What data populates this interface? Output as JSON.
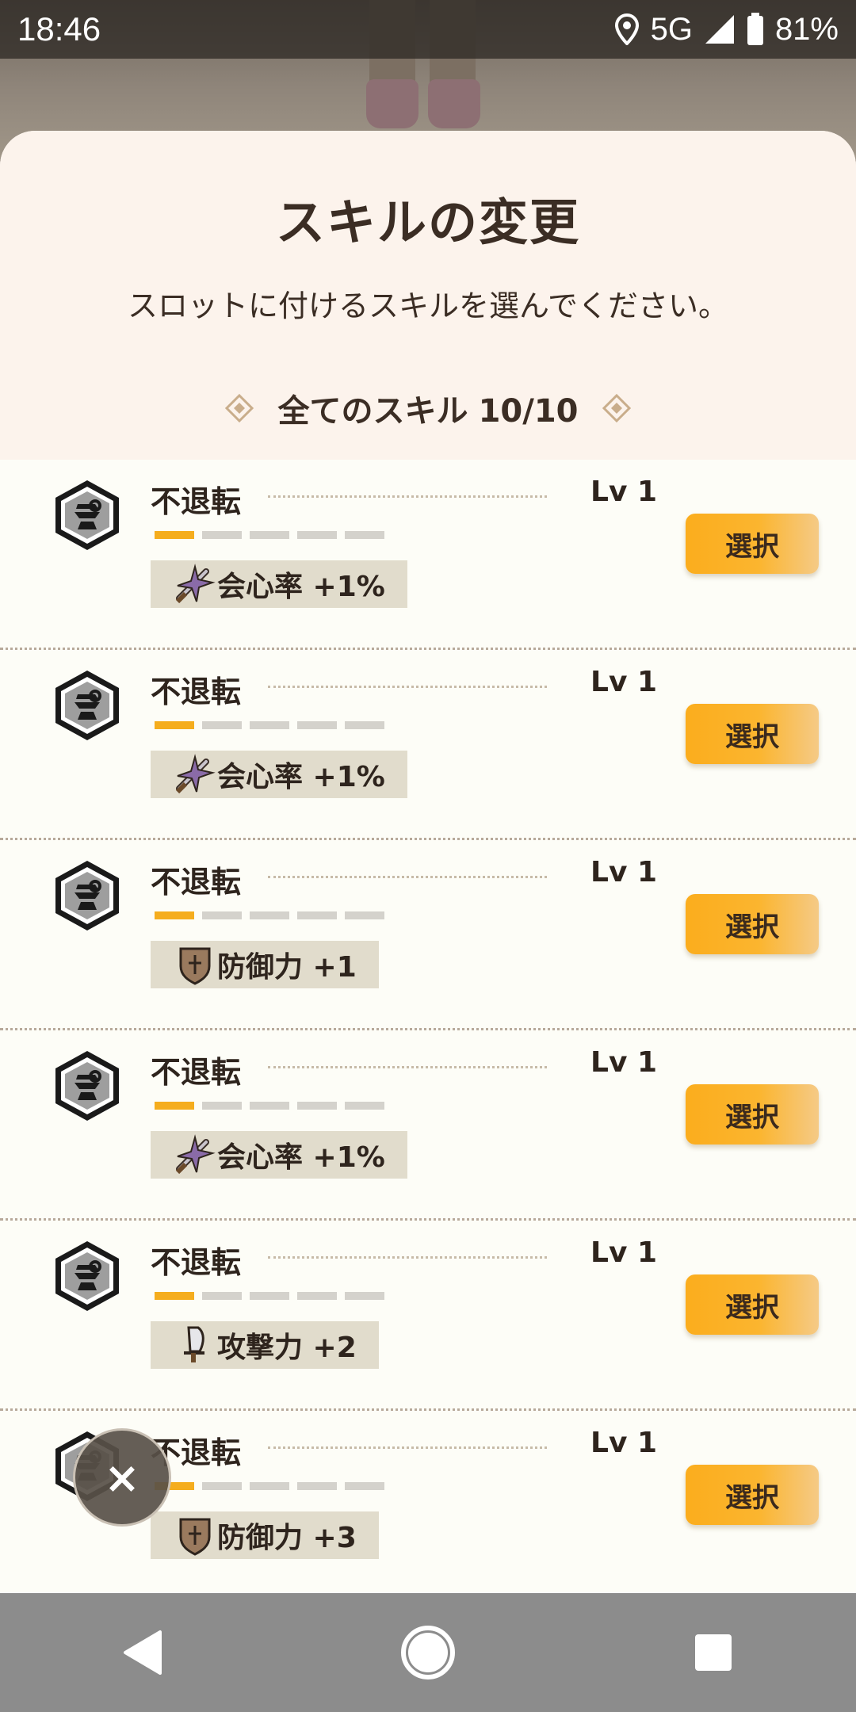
{
  "status_bar": {
    "time": "18:46",
    "network": "5G",
    "battery": "81%"
  },
  "sheet": {
    "title": "スキルの変更",
    "subtitle": "スロットに付けるスキルを選んでください。",
    "section": {
      "label": "全てのスキル",
      "count": "10/10"
    }
  },
  "skills": [
    {
      "name": "不退転",
      "level": "Lv 1",
      "level_progress": "1/5",
      "stat_icon": "crit-sword-icon",
      "stat": "会心率 +1%",
      "button": "選択"
    },
    {
      "name": "不退転",
      "level": "Lv 1",
      "level_progress": "1/5",
      "stat_icon": "crit-sword-icon",
      "stat": "会心率 +1%",
      "button": "選択"
    },
    {
      "name": "不退転",
      "level": "Lv 1",
      "level_progress": "1/5",
      "stat_icon": "shield-icon",
      "stat": "防御力 +1",
      "button": "選択"
    },
    {
      "name": "不退転",
      "level": "Lv 1",
      "level_progress": "1/5",
      "stat_icon": "crit-sword-icon",
      "stat": "会心率 +1%",
      "button": "選択"
    },
    {
      "name": "不退転",
      "level": "Lv 1",
      "level_progress": "1/5",
      "stat_icon": "blade-icon",
      "stat": "攻撃力 +2",
      "button": "選択"
    },
    {
      "name": "不退転",
      "level": "Lv 1",
      "level_progress": "1/5",
      "stat_icon": "shield-icon",
      "stat": "防御力 +3",
      "button": "選択"
    }
  ],
  "close_button": "×",
  "colors": {
    "accent": "#f5ad1e",
    "header_bg": "#fcf3ec",
    "list_bg": "#fdfdf7",
    "text": "#2e241d"
  }
}
